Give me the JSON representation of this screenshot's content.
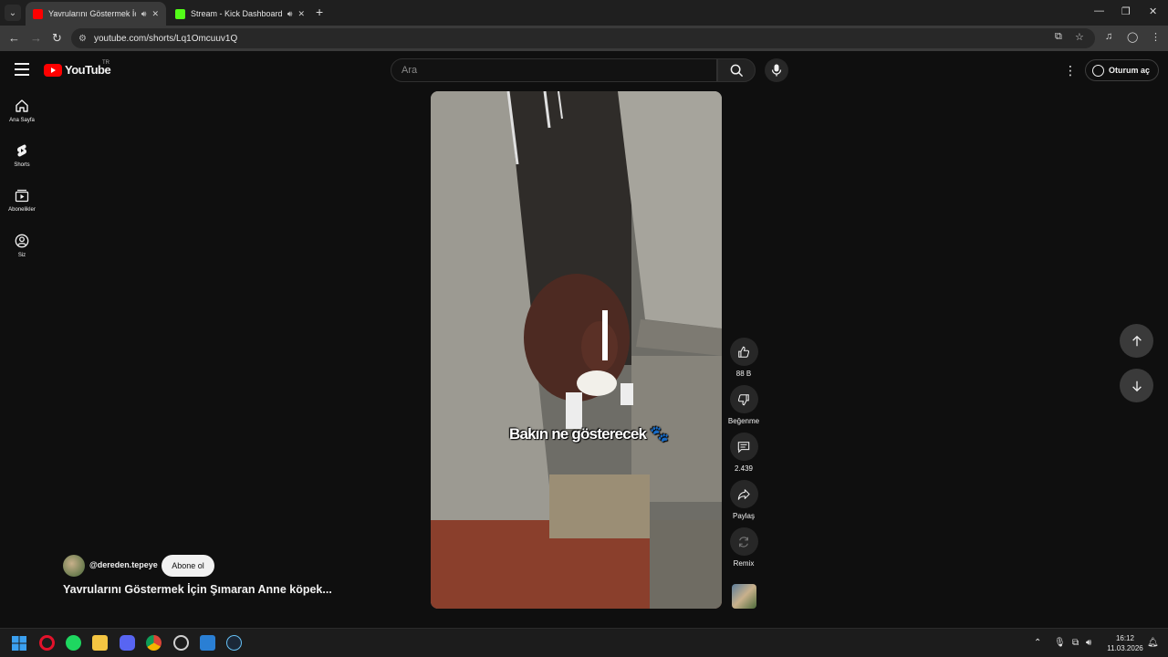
{
  "browser": {
    "tabs": [
      {
        "title": "Yavrularını Göstermek İçin Şımar...",
        "active": true,
        "favicon_color": "#ff0000"
      },
      {
        "title": "Stream - Kick Dashboard",
        "active": false,
        "favicon_color": "#53fc18"
      }
    ],
    "new_tab_label": "+",
    "url": "youtube.com/shorts/Lq1Omcuuv1Q"
  },
  "header": {
    "logo_text": "YouTube",
    "country_code": "TR",
    "search_placeholder": "Ara",
    "signin_label": "Oturum aç"
  },
  "guide": {
    "items": [
      {
        "label": "Ana Sayfa",
        "icon": "home-icon"
      },
      {
        "label": "Shorts",
        "icon": "shorts-icon"
      },
      {
        "label": "Abonelikler",
        "icon": "subscriptions-icon"
      },
      {
        "label": "Siz",
        "icon": "you-icon"
      }
    ]
  },
  "video": {
    "caption": "Bakın ne gösterecek 🐾",
    "channel": "@dereden.tepeye",
    "subscribe_label": "Abone ol",
    "title": "Yavrularını Göstermek İçin Şımaran Anne köpek..."
  },
  "actions": {
    "likes": "88 B",
    "dislike_label": "Beğenme",
    "comments": "2.439",
    "share_label": "Paylaş",
    "remix_label": "Remix"
  },
  "taskbar": {
    "time": "16:12",
    "date": "11.03.2026"
  }
}
